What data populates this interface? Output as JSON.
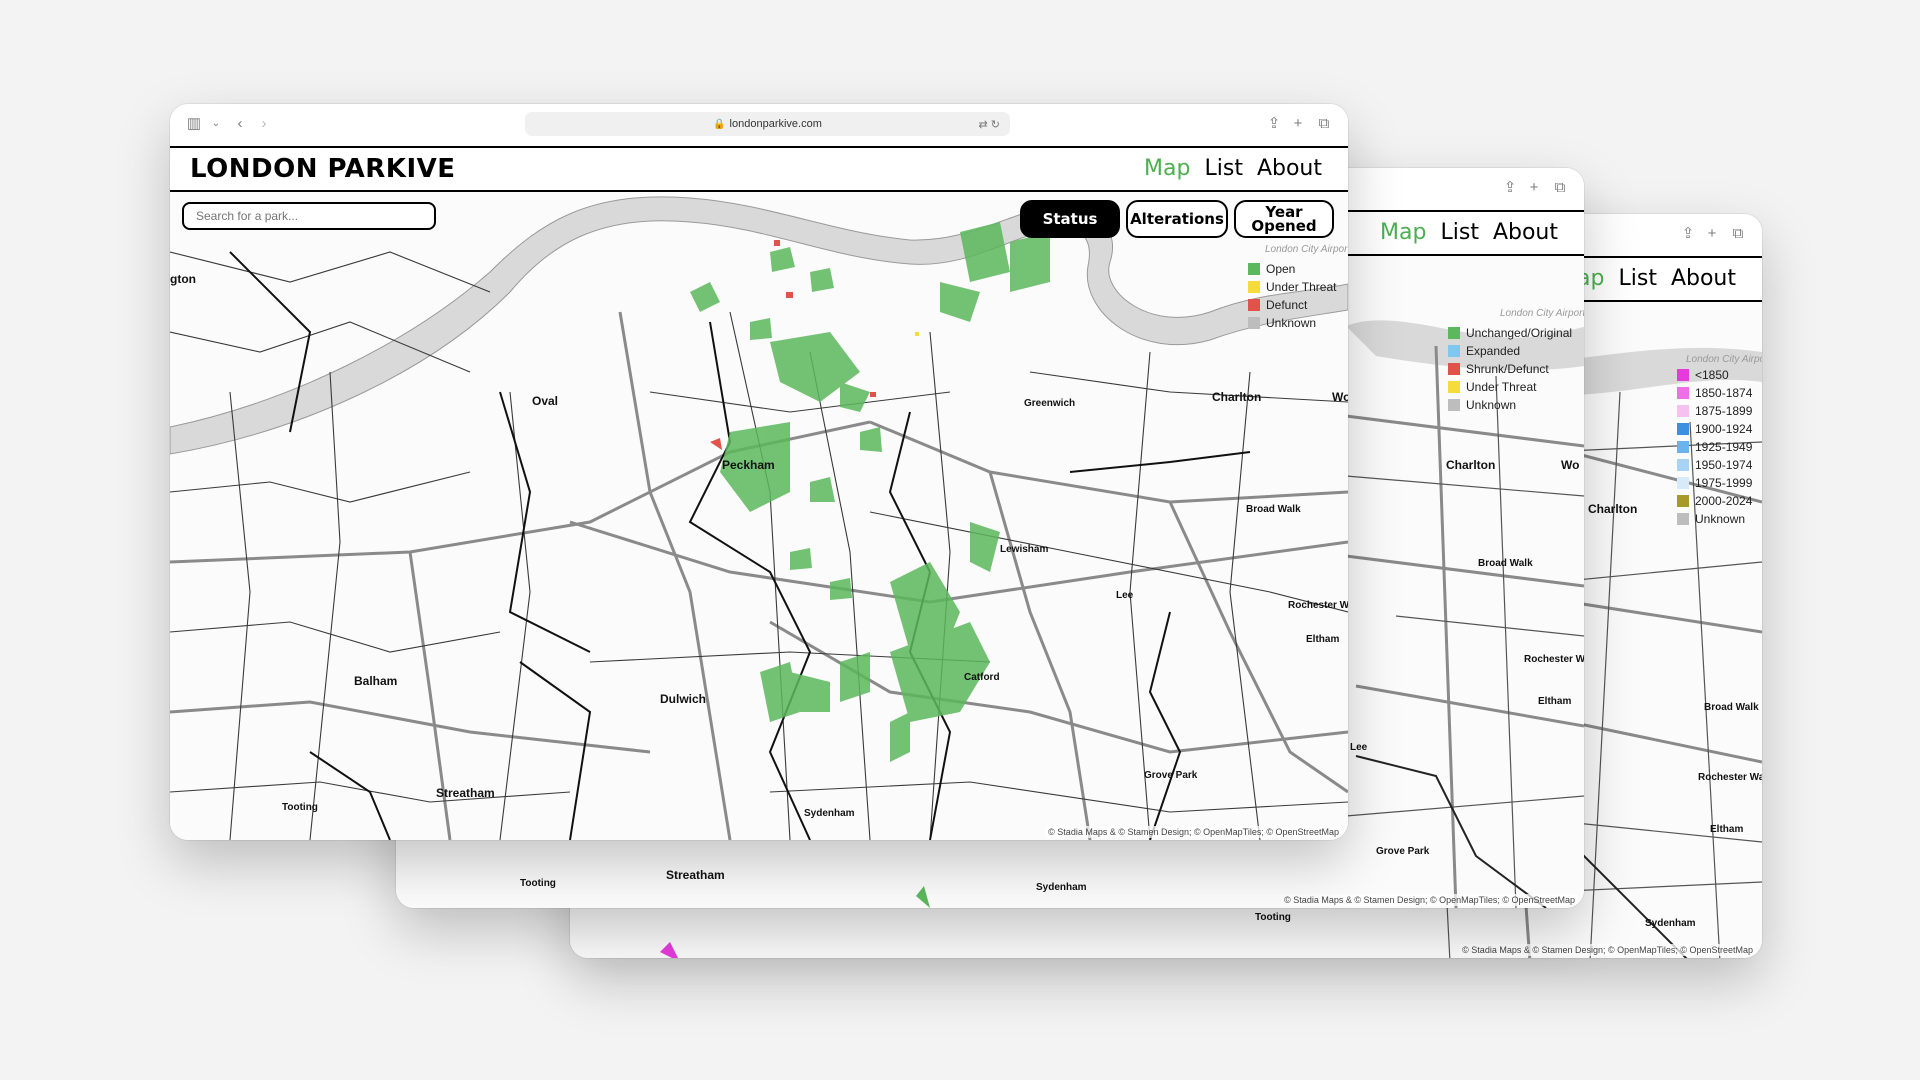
{
  "browser": {
    "url": "londonparkive.com"
  },
  "site": {
    "logo": "LONDON PARKIVE",
    "nav": [
      "Map",
      "List",
      "About"
    ],
    "search_placeholder": "Search for a park..."
  },
  "toggles": {
    "status": "Status",
    "alterations": "Alterations",
    "year_opened_line1": "Year",
    "year_opened_line2": "Opened"
  },
  "legends": {
    "status": [
      {
        "label": "Open",
        "color": "#5cb85c"
      },
      {
        "label": "Under Threat",
        "color": "#f5dc3b"
      },
      {
        "label": "Defunct",
        "color": "#e0524a"
      },
      {
        "label": "Unknown",
        "color": "#bdbdbd"
      }
    ],
    "alterations": [
      {
        "label": "Unchanged/Original",
        "color": "#5cb85c"
      },
      {
        "label": "Expanded",
        "color": "#7ec8f0"
      },
      {
        "label": "Shrunk/Defunct",
        "color": "#e0524a"
      },
      {
        "label": "Under Threat",
        "color": "#f5dc3b"
      },
      {
        "label": "Unknown",
        "color": "#bdbdbd"
      }
    ],
    "year_opened": [
      {
        "label": "<1850",
        "color": "#e63bdc"
      },
      {
        "label": "1850-1874",
        "color": "#ef6fe6"
      },
      {
        "label": "1875-1899",
        "color": "#f5c2f0"
      },
      {
        "label": "1900-1924",
        "color": "#3d8fe0"
      },
      {
        "label": "1925-1949",
        "color": "#6ab3ec"
      },
      {
        "label": "1950-1974",
        "color": "#a9d3f3"
      },
      {
        "label": "1975-1999",
        "color": "#d6eaf8"
      },
      {
        "label": "2000-2024",
        "color": "#a89a2a"
      },
      {
        "label": "Unknown",
        "color": "#bdbdbd"
      }
    ]
  },
  "map_labels": {
    "oval": "Oval",
    "peckham": "Peckham",
    "greenwich": "Greenwich",
    "charlton": "Charlton",
    "lewisham": "Lewisham",
    "lee": "Lee",
    "balham": "Balham",
    "dulwich": "Dulwich",
    "catford": "Catford",
    "streatham": "Streatham",
    "tooting": "Tooting",
    "sydenham": "Sydenham",
    "grove_park": "Grove Park",
    "broad_walk": "Broad Walk",
    "rochester_way": "Rochester Way",
    "eltham": "Eltham",
    "london_city_airport": "London City Airport",
    "kennington_fragment": "gton",
    "woolwich_fragment": "Wo"
  },
  "attribution": "© Stadia Maps & © Stamen Design; © OpenMapTiles; © OpenStreetMap"
}
